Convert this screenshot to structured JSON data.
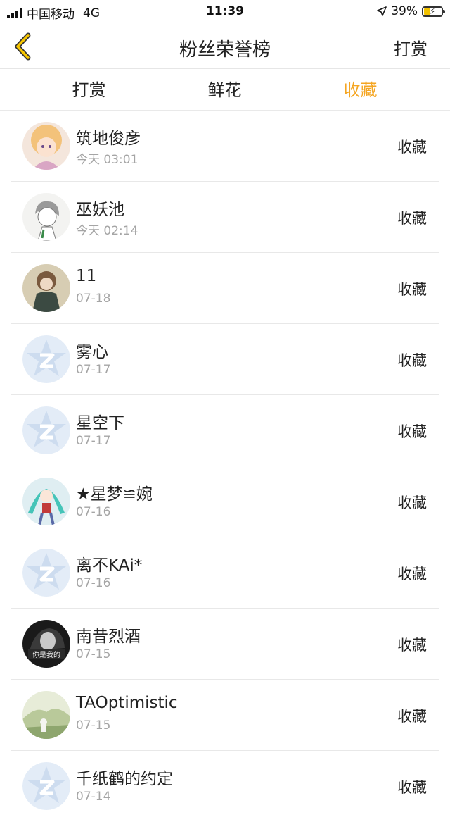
{
  "status_bar": {
    "carrier": "中国移动",
    "network": "4G",
    "time": "11:39",
    "battery": "39%"
  },
  "nav": {
    "title": "粉丝荣誉榜",
    "action": "打赏"
  },
  "tabs": [
    {
      "label": "打赏",
      "active": false
    },
    {
      "label": "鲜花",
      "active": false
    },
    {
      "label": "收藏",
      "active": true
    }
  ],
  "colors": {
    "accent": "#f5a623",
    "text": "#222222",
    "subtext": "#a5a5a5",
    "divider": "#e8e8e8"
  },
  "list": [
    {
      "name": "筑地俊彦",
      "time": "今天 03:01",
      "action": "收藏",
      "avatar": "anime-girl-avatar"
    },
    {
      "name": "巫妖池",
      "time": "今天 02:14",
      "action": "收藏",
      "avatar": "sketch-avatar"
    },
    {
      "name": "11",
      "time": "07-18",
      "action": "收藏",
      "avatar": "photo-girl-avatar"
    },
    {
      "name": "雾心",
      "time": "07-17",
      "action": "收藏",
      "avatar": "default-avatar"
    },
    {
      "name": "星空下",
      "time": "07-17",
      "action": "收藏",
      "avatar": "default-avatar"
    },
    {
      "name": "★星梦≌婉",
      "time": "07-16",
      "action": "收藏",
      "avatar": "miku-avatar"
    },
    {
      "name": "离不KAi*",
      "time": "07-16",
      "action": "收藏",
      "avatar": "default-avatar"
    },
    {
      "name": "南昔烈酒",
      "time": "07-15",
      "action": "收藏",
      "avatar": "bw-photo-avatar"
    },
    {
      "name": "TAOptimistic",
      "time": "07-15",
      "action": "收藏",
      "avatar": "scenery-avatar"
    },
    {
      "name": "千纸鹤的约定",
      "time": "07-14",
      "action": "收藏",
      "avatar": "default-avatar"
    }
  ]
}
